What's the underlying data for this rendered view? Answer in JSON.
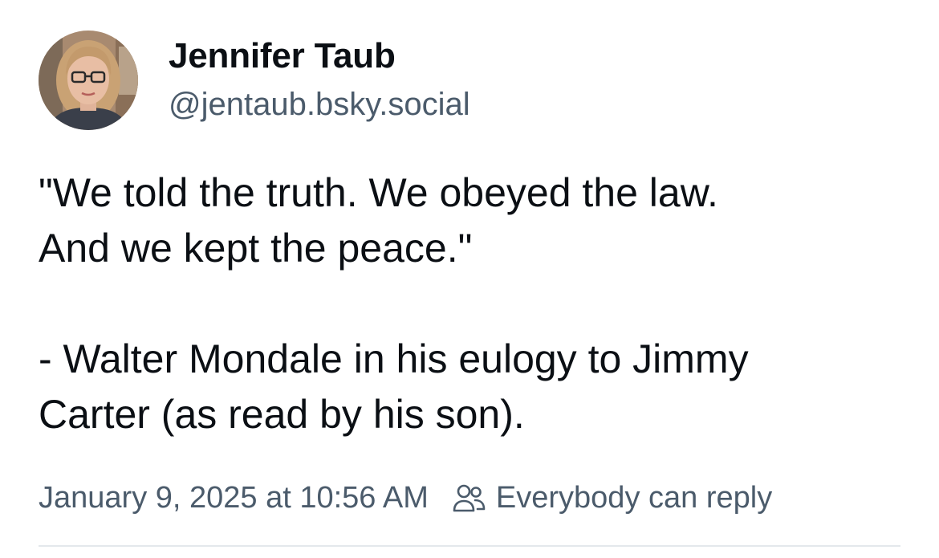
{
  "post": {
    "author": {
      "display_name": "Jennifer Taub",
      "handle": "@jentaub.bsky.social"
    },
    "text": "\"We told the truth. We obeyed the law.\nAnd we kept the peace.\"\n\n- Walter Mondale in his eulogy to Jimmy\nCarter (as read by his son).",
    "timestamp": "January 9, 2025 at 10:56 AM",
    "reply_setting": "Everybody can reply",
    "reply_icon": "people-icon"
  },
  "colors": {
    "text": "#0b0f14",
    "secondary_text": "#4b5b6b",
    "divider": "#e4e8ec"
  }
}
